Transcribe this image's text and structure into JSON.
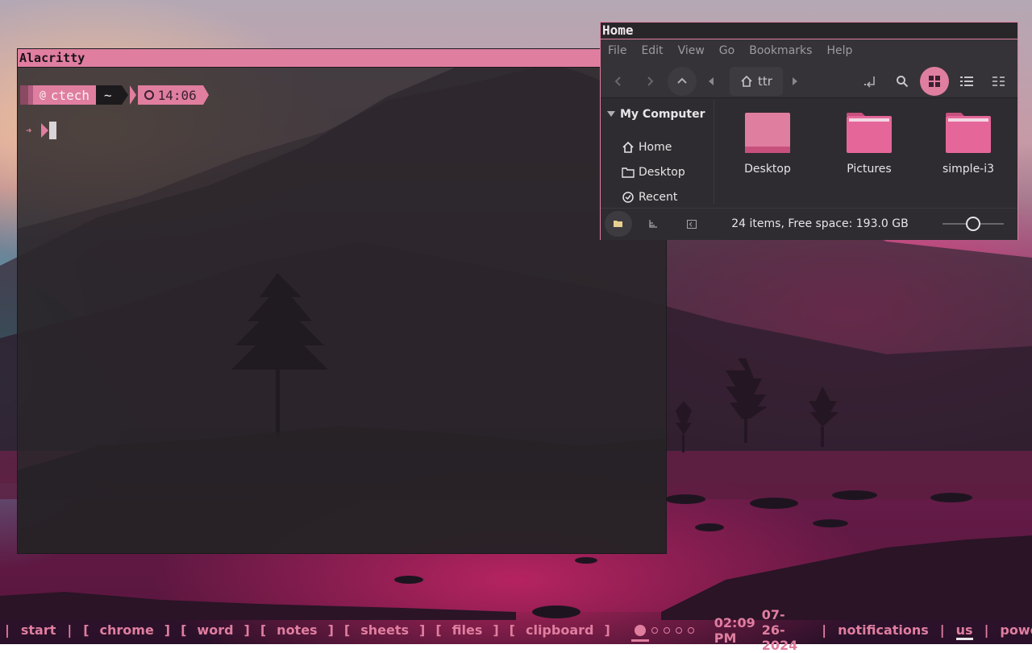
{
  "terminal": {
    "title": "Alacritty",
    "prompt_user": "ctech",
    "prompt_dir": "~",
    "prompt_time": "14:06",
    "cursor_symbol": "➜"
  },
  "file_manager": {
    "title": "Home",
    "menu": [
      "File",
      "Edit",
      "View",
      "Go",
      "Bookmarks",
      "Help"
    ],
    "location": "ttr",
    "sidebar_header": "My Computer",
    "sidebar_items": [
      "Home",
      "Desktop",
      "Recent"
    ],
    "files": [
      "Desktop",
      "Pictures",
      "simple-i3"
    ],
    "status": "24 items, Free space: 193.0 GB",
    "zoom_level": 0.5
  },
  "taskbar": {
    "start": "start",
    "apps": [
      "chrome",
      "word",
      "notes",
      "sheets",
      "files",
      "clipboard"
    ],
    "workspaces": 5,
    "active_workspace": 1,
    "time": "02:09 PM",
    "date": "07-26-2024",
    "notifications": "notifications",
    "layout": "us",
    "power": "power"
  },
  "colors": {
    "accent": "#e07ea0",
    "folder": "#e5679a"
  }
}
